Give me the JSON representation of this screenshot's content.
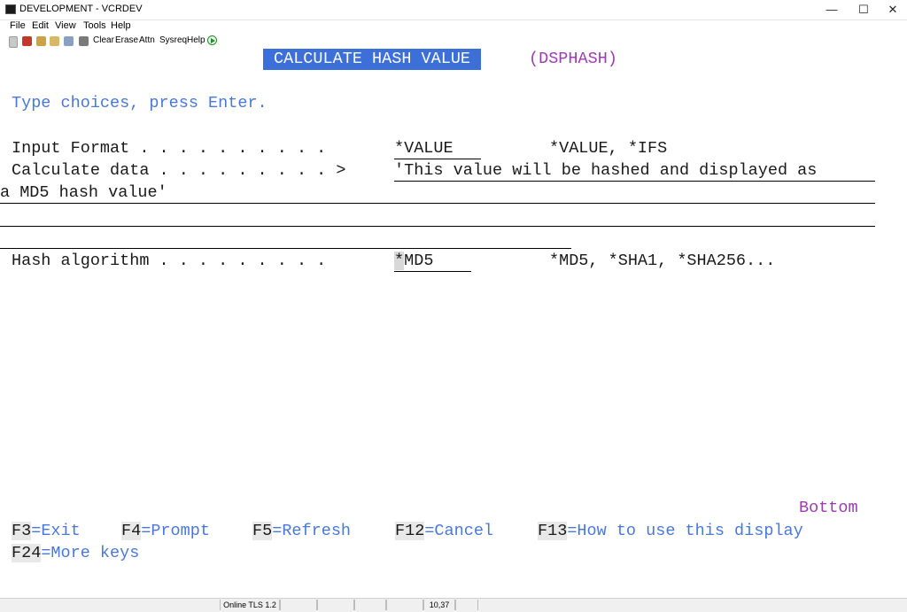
{
  "window": {
    "title": "DEVELOPMENT - VCRDEV",
    "minimize": "—",
    "maximize": "☐",
    "close": "✕"
  },
  "menu": [
    "File",
    "Edit",
    "View",
    "Tools",
    "Help"
  ],
  "toolbar": {
    "buttons": [
      "Clear",
      "Erase",
      "Attn",
      "Sysreq",
      "Help"
    ]
  },
  "screen": {
    "title": "CALCULATE HASH VALUE",
    "command": "(DSPHASH)",
    "instruction": "Type choices, press Enter.",
    "fields": {
      "input_format": {
        "label": "Input Format . . . . . . . . . .",
        "value": "*VALUE",
        "choices": "*VALUE, *IFS"
      },
      "calculate_data": {
        "label": "Calculate data . . . . . . . . . >",
        "value_line1": "'This value will be hashed and displayed as",
        "value_line2": "a MD5 hash value'"
      },
      "hash_algorithm": {
        "label": "Hash algorithm . . . . . . . . .",
        "value_first": "*",
        "value_rest": "MD5",
        "choices": "*MD5, *SHA1, *SHA256..."
      }
    },
    "bottom": "Bottom",
    "function_keys": [
      {
        "key": "F3",
        "label": "=Exit"
      },
      {
        "key": "F4",
        "label": "=Prompt"
      },
      {
        "key": "F5",
        "label": "=Refresh"
      },
      {
        "key": "F12",
        "label": "=Cancel"
      },
      {
        "key": "F13",
        "label": "=How to use this display"
      },
      {
        "key": "F24",
        "label": "=More keys"
      }
    ]
  },
  "status": {
    "connection": "Online TLS 1.2",
    "cursor_position": "10,37"
  }
}
